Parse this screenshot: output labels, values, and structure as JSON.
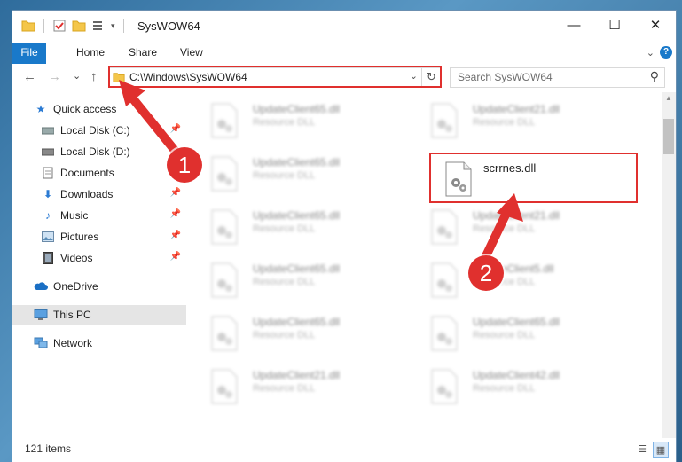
{
  "window": {
    "title": "SysWOW64",
    "controls": {
      "minimize": "—",
      "maximize": "☐",
      "close": "✕"
    }
  },
  "ribbon": {
    "tabs": [
      "File",
      "Home",
      "Share",
      "View"
    ],
    "help": "?"
  },
  "nav": {
    "back": "←",
    "forward": "→",
    "recent": "⌄",
    "up": "↑",
    "address": "C:\\Windows\\SysWOW64",
    "search_placeholder": "Search SysWOW64"
  },
  "sidebar": {
    "items": [
      {
        "label": "Quick access",
        "icon": "star-icon",
        "pinned": false
      },
      {
        "label": "Local Disk (C:)",
        "icon": "drive-icon",
        "pinned": true
      },
      {
        "label": "Local Disk (D:)",
        "icon": "drive-icon",
        "pinned": false
      },
      {
        "label": "Documents",
        "icon": "documents-icon",
        "pinned": false
      },
      {
        "label": "Downloads",
        "icon": "downloads-icon",
        "pinned": true
      },
      {
        "label": "Music",
        "icon": "music-icon",
        "pinned": true
      },
      {
        "label": "Pictures",
        "icon": "pictures-icon",
        "pinned": true
      },
      {
        "label": "Videos",
        "icon": "videos-icon",
        "pinned": true
      },
      {
        "label": "OneDrive",
        "icon": "cloud-icon",
        "pinned": false
      },
      {
        "label": "This PC",
        "icon": "computer-icon",
        "pinned": false
      },
      {
        "label": "Network",
        "icon": "network-icon",
        "pinned": false
      }
    ]
  },
  "files": [
    {
      "name": "UpdateClient65.dll",
      "type": "Resource DLL"
    },
    {
      "name": "UpdateClient21.dll",
      "type": "Resource DLL"
    },
    {
      "name": "UpdateClient65.dll",
      "type": "Resource DLL"
    },
    {
      "name": "scrrnes.dll",
      "type": ""
    },
    {
      "name": "UpdateClient65.dll",
      "type": "Resource DLL"
    },
    {
      "name": "UpdateClient21.dll",
      "type": "Resource DLL"
    },
    {
      "name": "UpdateClient65.dll",
      "type": "Resource DLL"
    },
    {
      "name": "UpdateClient5.dll",
      "type": "Resource DLL"
    },
    {
      "name": "UpdateClient65.dll",
      "type": "Resource DLL"
    },
    {
      "name": "UpdateClient65.dll",
      "type": "Resource DLL"
    },
    {
      "name": "UpdateClient21.dll",
      "type": "Resource DLL"
    },
    {
      "name": "UpdateClient42.dll",
      "type": "Resource DLL"
    }
  ],
  "status": {
    "item_count": "121 items"
  },
  "annotations": {
    "step1": "1",
    "step2": "2"
  },
  "colors": {
    "accent": "#1979ca",
    "annotation": "#e0302e"
  }
}
